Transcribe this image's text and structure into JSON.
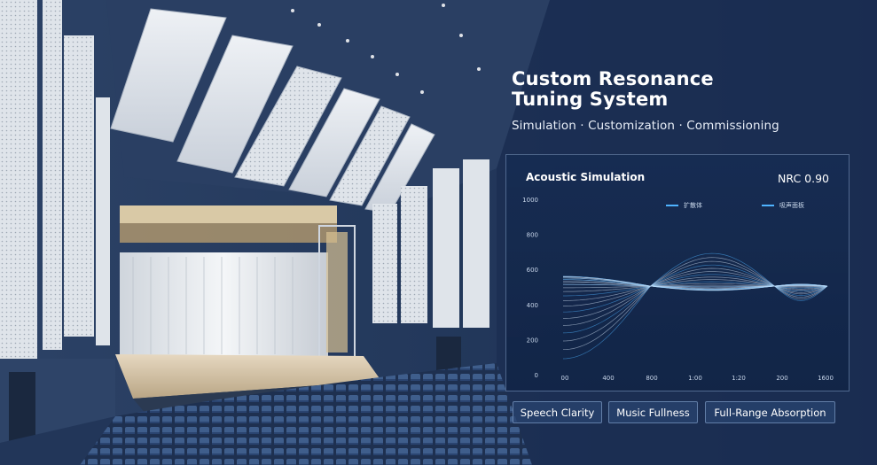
{
  "headline": {
    "title_line1": "Custom Resonance",
    "title_line2": "Tuning System",
    "subtitle": "Simulation · Customization · Commissioning"
  },
  "panel": {
    "title": "Acoustic Simulation",
    "metric": "NRC 0.90",
    "legend": [
      "扩散体",
      "吸声面板"
    ]
  },
  "chips": [
    "Speech Clarity",
    "Music Fullness",
    "Full-Range Absorption"
  ],
  "colors": {
    "accent": "#4fb3ff",
    "background": "#1a2b48"
  },
  "chart_data": {
    "type": "line",
    "x_ticks": [
      "00",
      "400",
      "800",
      "1:00",
      "1:20",
      "200",
      "1600"
    ],
    "y_ticks": [
      "1000",
      "800",
      "600",
      "400",
      "200",
      "0"
    ],
    "series_count": 24
  }
}
